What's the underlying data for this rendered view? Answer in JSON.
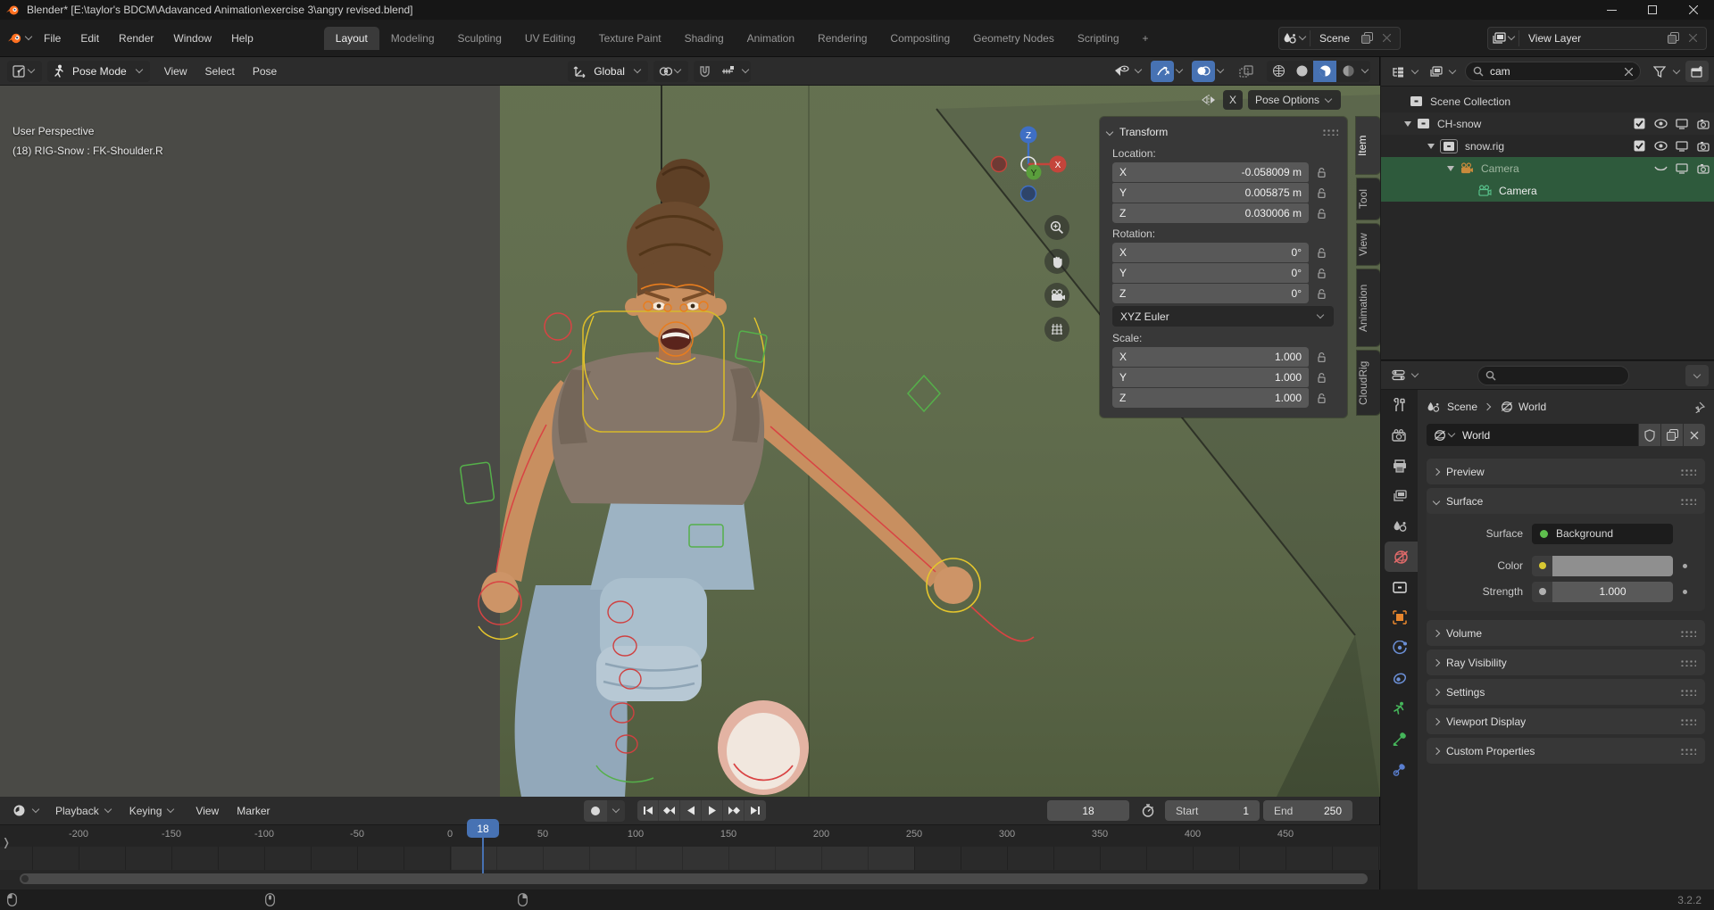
{
  "window": {
    "title": "Blender* [E:\\taylor's BDCM\\Adavanced Animation\\exercise 3\\angry revised.blend]",
    "minimize": "–",
    "maximize": "▢",
    "close": "✕"
  },
  "topbar": {
    "menus": [
      "File",
      "Edit",
      "Render",
      "Window",
      "Help"
    ],
    "workspaces": [
      "Layout",
      "Modeling",
      "Sculpting",
      "UV Editing",
      "Texture Paint",
      "Shading",
      "Animation",
      "Rendering",
      "Compositing",
      "Geometry Nodes",
      "Scripting",
      "+"
    ],
    "active_workspace": "Layout",
    "scene_label": "Scene",
    "view_layer_label": "View Layer"
  },
  "viewport": {
    "header": {
      "mode_label": "Pose Mode",
      "menus": [
        "View",
        "Select",
        "Pose"
      ],
      "orientation_label": "Global"
    },
    "tool_settings": {
      "mirror_label": "X",
      "pose_options_label": "Pose Options"
    },
    "overlay": {
      "line1": "User Perspective",
      "line2": "(18) RIG-Snow : FK-Shoulder.R"
    },
    "gizmo_axes": {
      "x": "X",
      "y": "Y",
      "z": "Z"
    }
  },
  "transform_panel": {
    "title": "Transform",
    "tabs": [
      "Item",
      "Tool",
      "View",
      "Animation",
      "CloudRig"
    ],
    "active_tab": "Item",
    "location_label": "Location:",
    "location": [
      {
        "axis": "X",
        "value": "-0.058009 m"
      },
      {
        "axis": "Y",
        "value": "0.005875 m"
      },
      {
        "axis": "Z",
        "value": "0.030006 m"
      }
    ],
    "rotation_label": "Rotation:",
    "rotation": [
      {
        "axis": "X",
        "value": "0°"
      },
      {
        "axis": "Y",
        "value": "0°"
      },
      {
        "axis": "Z",
        "value": "0°"
      }
    ],
    "rotation_mode": "XYZ Euler",
    "scale_label": "Scale:",
    "scale": [
      {
        "axis": "X",
        "value": "1.000"
      },
      {
        "axis": "Y",
        "value": "1.000"
      },
      {
        "axis": "Z",
        "value": "1.000"
      }
    ]
  },
  "outliner": {
    "search_value": "cam",
    "rows": [
      {
        "label": "Scene Collection"
      },
      {
        "label": "CH-snow"
      },
      {
        "label": "snow.rig"
      },
      {
        "label": "Camera"
      },
      {
        "label": "Camera"
      }
    ]
  },
  "properties": {
    "breadcrumb": {
      "scene": "Scene",
      "target": "World"
    },
    "datablock_name": "World",
    "panels": {
      "preview": "Preview",
      "surface": "Surface",
      "volume": "Volume",
      "ray_visibility": "Ray Visibility",
      "settings": "Settings",
      "viewport_display": "Viewport Display",
      "custom_properties": "Custom Properties"
    },
    "surface_fields": {
      "surface_label": "Surface",
      "surface_value": "Background",
      "color_label": "Color",
      "strength_label": "Strength",
      "strength_value": "1.000"
    },
    "tab_icons": [
      "tool",
      "render",
      "output",
      "view-layer",
      "scene",
      "world",
      "collection",
      "object",
      "physics",
      "constraints",
      "object-data",
      "bone",
      "bone-constraints"
    ],
    "active_tab_icon": "world"
  },
  "timeline": {
    "menus": [
      "Playback",
      "Keying",
      "View",
      "Marker"
    ],
    "current_frame": "18",
    "start_label": "Start",
    "start_value": "1",
    "end_label": "End",
    "end_value": "250",
    "ticks": [
      "-200",
      "-150",
      "-100",
      "-50",
      "0",
      "50",
      "100",
      "150",
      "200",
      "250",
      "300",
      "350",
      "400",
      "450"
    ]
  },
  "statusbar": {
    "version": "3.2.2"
  },
  "colors": {
    "accent_blue": "#4772b3",
    "selection_green": "#2e5a3c",
    "world_tab_red": "#e06a6a",
    "object_orange": "#e8862d",
    "armature_green": "#45b55a",
    "bone_constraint_blue": "#5a7fd0",
    "overlay_orange": "#e87d1e",
    "overlay_yellow": "#e6c62c",
    "overlay_red": "#d94343",
    "overlay_green": "#55b04a"
  }
}
